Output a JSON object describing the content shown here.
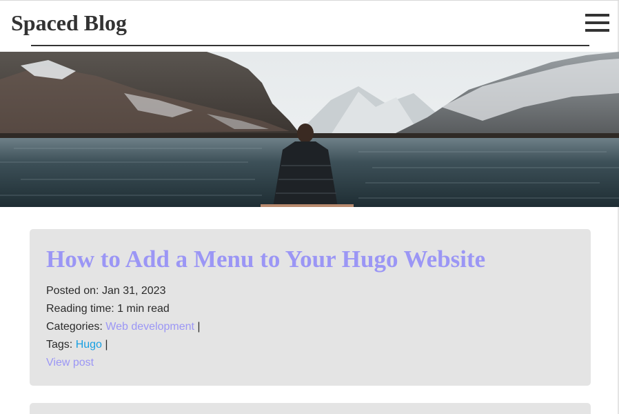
{
  "header": {
    "site_title": "Spaced Blog",
    "menu_icon": "hamburger-menu-icon"
  },
  "hero": {
    "image": "person-sitting-by-mountain-lake"
  },
  "post": {
    "title": "How to Add a Menu to Your Hugo Website",
    "posted_label": "Posted on:",
    "posted_date": "Jan 31, 2023",
    "reading_label": "Reading time:",
    "reading_time": "1 min read",
    "categories_label": "Categories:",
    "categories": [
      "Web development"
    ],
    "tags_label": "Tags:",
    "tags": [
      "Hugo"
    ],
    "separator": "|",
    "view_post": "View post"
  },
  "colors": {
    "title_link": "#9b96f5",
    "tag_link": "#18a0e2",
    "card_background": "#e4e4e4",
    "text": "#333333"
  }
}
